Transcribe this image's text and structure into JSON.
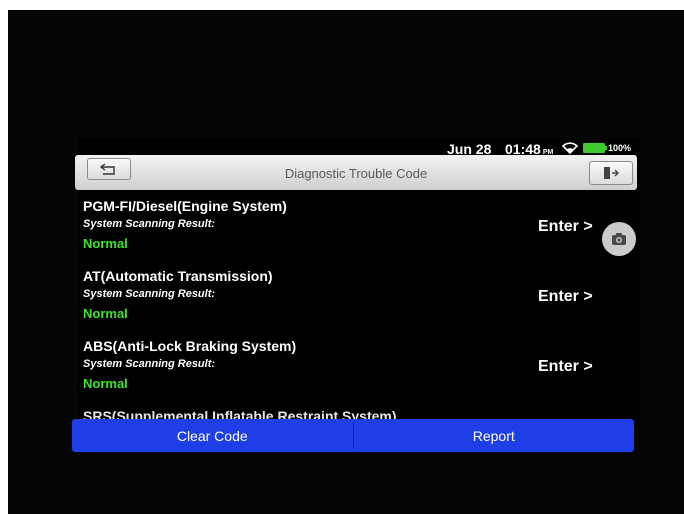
{
  "status_bar": {
    "date": "Jun 28",
    "time": "01:48",
    "ampm": "PM",
    "battery": "100%"
  },
  "header": {
    "title": "Diagnostic Trouble Code"
  },
  "systems": [
    {
      "name": "PGM-FI/Diesel(Engine System)",
      "result_label": "System Scanning Result:",
      "result": "Normal",
      "action": "Enter >"
    },
    {
      "name": "AT(Automatic Transmission)",
      "result_label": "System Scanning Result:",
      "result": "Normal",
      "action": "Enter >"
    },
    {
      "name": "ABS(Anti-Lock Braking System)",
      "result_label": "System Scanning Result:",
      "result": "Normal",
      "action": "Enter >"
    },
    {
      "name": "SRS(Supplemental Inflatable Restraint System)"
    }
  ],
  "footer": {
    "clear_code": "Clear Code",
    "report": "Report"
  },
  "colors": {
    "accent_blue": "#1f3fe6",
    "normal_green": "#3ee52a",
    "battery_green": "#3ecb2c"
  }
}
